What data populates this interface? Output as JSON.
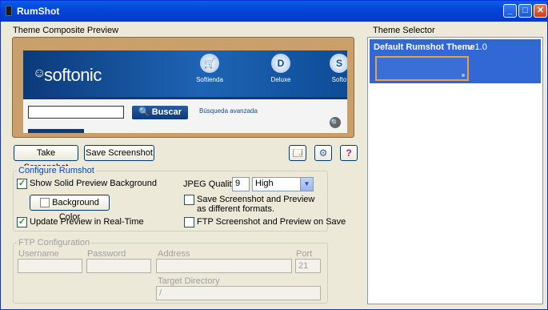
{
  "window": {
    "title": "RumShot"
  },
  "titlebar": {
    "min": "_",
    "max": "□",
    "close": "✕"
  },
  "preview": {
    "label": "Theme Composite Preview",
    "logo": "softonic",
    "nav": [
      "Softienda",
      "Deluxe",
      "Softo"
    ],
    "search_button": "Buscar",
    "advanced_link": "Búsqueda avanzada"
  },
  "actions": {
    "take_screenshot": "Take Screenshot",
    "save_screenshot": "Save Screenshot",
    "icons": [
      "preview-window-icon",
      "settings-gear-icon",
      "help-icon"
    ]
  },
  "configure": {
    "legend": "Configure Rumshot",
    "show_solid_bg": {
      "label": "Show Solid Preview Background",
      "checked": true
    },
    "background_color_button": "Background Color",
    "update_realtime": {
      "label": "Update Preview in Real-Time",
      "checked": true
    },
    "jpeg_quality_label": "JPEG Quality",
    "jpeg_quality_value": "9",
    "quality_select": "High",
    "save_formats": {
      "label": "Save Screenshot and Preview as different formats.",
      "checked": false
    },
    "ftp_save": {
      "label": "FTP Screenshot and Preview on Save",
      "checked": false
    }
  },
  "ftp": {
    "legend": "FTP Configuration",
    "username_label": "Username",
    "password_label": "Password",
    "address_label": "Address",
    "port_label": "Port",
    "port_value": "21",
    "target_dir_label": "Target Directory",
    "target_dir_value": "/"
  },
  "theme_selector": {
    "label": "Theme Selector",
    "items": [
      {
        "name": "Default Rumshot Theme",
        "version": "v 1.0"
      }
    ]
  }
}
